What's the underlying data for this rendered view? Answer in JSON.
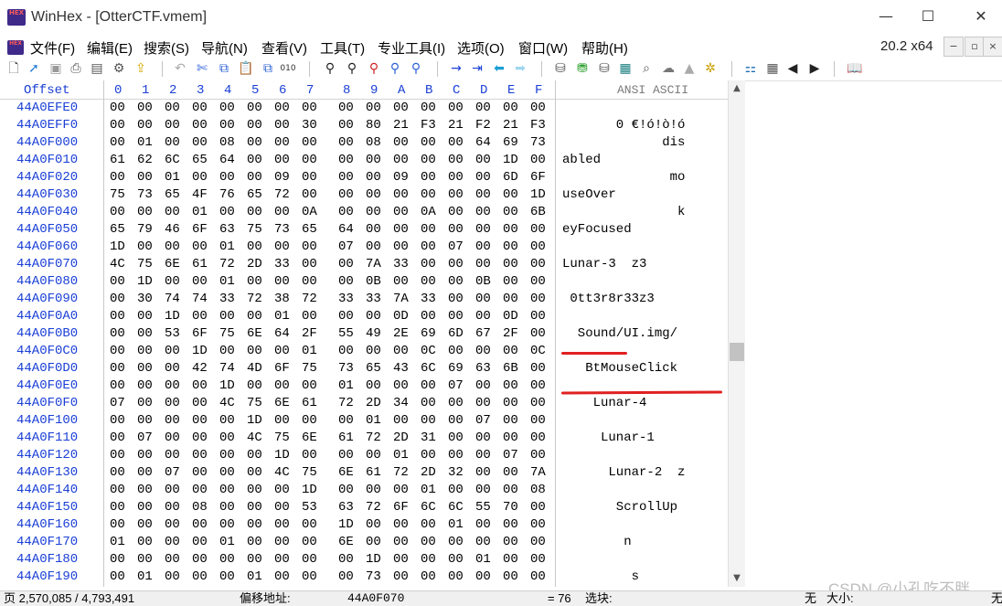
{
  "window": {
    "title": "WinHex - [OtterCTF.vmem]",
    "logo_text": "HEX",
    "minimize": "—",
    "maximize": "☐",
    "close": "✕"
  },
  "menu": {
    "items": [
      "文件(F)",
      "编辑(E)",
      "搜索(S)",
      "导航(N)",
      "查看(V)",
      "工具(T)",
      "专业工具(I)",
      "选项(O)",
      "窗口(W)",
      "帮助(H)"
    ],
    "version": "20.2 x64",
    "mdi": [
      "−",
      "▫",
      "×"
    ]
  },
  "hex": {
    "offset_label": "Offset",
    "column_labels": [
      "0",
      "1",
      "2",
      "3",
      "4",
      "5",
      "6",
      "7",
      "8",
      "9",
      "A",
      "B",
      "C",
      "D",
      "E",
      "F"
    ],
    "ascii_label": "ANSI ASCII",
    "rows": [
      {
        "offset": "44A0EFE0",
        "bytes": [
          "00",
          "00",
          "00",
          "00",
          "00",
          "00",
          "00",
          "00",
          "00",
          "00",
          "00",
          "00",
          "00",
          "00",
          "00",
          "00"
        ],
        "ascii": ""
      },
      {
        "offset": "44A0EFF0",
        "bytes": [
          "00",
          "00",
          "00",
          "00",
          "00",
          "00",
          "00",
          "30",
          "00",
          "80",
          "21",
          "F3",
          "21",
          "F2",
          "21",
          "F3"
        ],
        "ascii": "       0 €!ó!ò!ó"
      },
      {
        "offset": "44A0F000",
        "bytes": [
          "00",
          "01",
          "00",
          "00",
          "08",
          "00",
          "00",
          "00",
          "00",
          "08",
          "00",
          "00",
          "00",
          "64",
          "69",
          "73"
        ],
        "ascii": "             dis"
      },
      {
        "offset": "44A0F010",
        "bytes": [
          "61",
          "62",
          "6C",
          "65",
          "64",
          "00",
          "00",
          "00",
          "00",
          "00",
          "00",
          "00",
          "00",
          "00",
          "1D",
          "00"
        ],
        "ascii": "abled"
      },
      {
        "offset": "44A0F020",
        "bytes": [
          "00",
          "00",
          "01",
          "00",
          "00",
          "00",
          "09",
          "00",
          "00",
          "00",
          "09",
          "00",
          "00",
          "00",
          "6D",
          "6F"
        ],
        "ascii": "              mo"
      },
      {
        "offset": "44A0F030",
        "bytes": [
          "75",
          "73",
          "65",
          "4F",
          "76",
          "65",
          "72",
          "00",
          "00",
          "00",
          "00",
          "00",
          "00",
          "00",
          "00",
          "1D"
        ],
        "ascii": "useOver"
      },
      {
        "offset": "44A0F040",
        "bytes": [
          "00",
          "00",
          "00",
          "01",
          "00",
          "00",
          "00",
          "0A",
          "00",
          "00",
          "00",
          "0A",
          "00",
          "00",
          "00",
          "6B"
        ],
        "ascii": "               k"
      },
      {
        "offset": "44A0F050",
        "bytes": [
          "65",
          "79",
          "46",
          "6F",
          "63",
          "75",
          "73",
          "65",
          "64",
          "00",
          "00",
          "00",
          "00",
          "00",
          "00",
          "00"
        ],
        "ascii": "eyFocused"
      },
      {
        "offset": "44A0F060",
        "bytes": [
          "1D",
          "00",
          "00",
          "00",
          "01",
          "00",
          "00",
          "00",
          "07",
          "00",
          "00",
          "00",
          "07",
          "00",
          "00",
          "00"
        ],
        "ascii": ""
      },
      {
        "offset": "44A0F070",
        "bytes": [
          "4C",
          "75",
          "6E",
          "61",
          "72",
          "2D",
          "33",
          "00",
          "00",
          "7A",
          "33",
          "00",
          "00",
          "00",
          "00",
          "00"
        ],
        "ascii": "Lunar-3  z3"
      },
      {
        "offset": "44A0F080",
        "bytes": [
          "00",
          "1D",
          "00",
          "00",
          "01",
          "00",
          "00",
          "00",
          "00",
          "0B",
          "00",
          "00",
          "00",
          "0B",
          "00",
          "00"
        ],
        "ascii": ""
      },
      {
        "offset": "44A0F090",
        "bytes": [
          "00",
          "30",
          "74",
          "74",
          "33",
          "72",
          "38",
          "72",
          "33",
          "33",
          "7A",
          "33",
          "00",
          "00",
          "00",
          "00"
        ],
        "ascii": " 0tt3r8r33z3"
      },
      {
        "offset": "44A0F0A0",
        "bytes": [
          "00",
          "00",
          "1D",
          "00",
          "00",
          "00",
          "01",
          "00",
          "00",
          "00",
          "0D",
          "00",
          "00",
          "00",
          "0D",
          "00"
        ],
        "ascii": ""
      },
      {
        "offset": "44A0F0B0",
        "bytes": [
          "00",
          "00",
          "53",
          "6F",
          "75",
          "6E",
          "64",
          "2F",
          "55",
          "49",
          "2E",
          "69",
          "6D",
          "67",
          "2F",
          "00"
        ],
        "ascii": "  Sound/UI.img/"
      },
      {
        "offset": "44A0F0C0",
        "bytes": [
          "00",
          "00",
          "00",
          "1D",
          "00",
          "00",
          "00",
          "01",
          "00",
          "00",
          "00",
          "0C",
          "00",
          "00",
          "00",
          "0C"
        ],
        "ascii": ""
      },
      {
        "offset": "44A0F0D0",
        "bytes": [
          "00",
          "00",
          "00",
          "42",
          "74",
          "4D",
          "6F",
          "75",
          "73",
          "65",
          "43",
          "6C",
          "69",
          "63",
          "6B",
          "00"
        ],
        "ascii": "   BtMouseClick"
      },
      {
        "offset": "44A0F0E0",
        "bytes": [
          "00",
          "00",
          "00",
          "00",
          "1D",
          "00",
          "00",
          "00",
          "01",
          "00",
          "00",
          "00",
          "07",
          "00",
          "00",
          "00"
        ],
        "ascii": ""
      },
      {
        "offset": "44A0F0F0",
        "bytes": [
          "07",
          "00",
          "00",
          "00",
          "4C",
          "75",
          "6E",
          "61",
          "72",
          "2D",
          "34",
          "00",
          "00",
          "00",
          "00",
          "00"
        ],
        "ascii": "    Lunar-4"
      },
      {
        "offset": "44A0F100",
        "bytes": [
          "00",
          "00",
          "00",
          "00",
          "00",
          "1D",
          "00",
          "00",
          "00",
          "01",
          "00",
          "00",
          "00",
          "07",
          "00",
          "00"
        ],
        "ascii": ""
      },
      {
        "offset": "44A0F110",
        "bytes": [
          "00",
          "07",
          "00",
          "00",
          "00",
          "4C",
          "75",
          "6E",
          "61",
          "72",
          "2D",
          "31",
          "00",
          "00",
          "00",
          "00"
        ],
        "ascii": "     Lunar-1"
      },
      {
        "offset": "44A0F120",
        "bytes": [
          "00",
          "00",
          "00",
          "00",
          "00",
          "00",
          "1D",
          "00",
          "00",
          "00",
          "01",
          "00",
          "00",
          "00",
          "07",
          "00"
        ],
        "ascii": ""
      },
      {
        "offset": "44A0F130",
        "bytes": [
          "00",
          "00",
          "07",
          "00",
          "00",
          "00",
          "4C",
          "75",
          "6E",
          "61",
          "72",
          "2D",
          "32",
          "00",
          "00",
          "7A"
        ],
        "ascii": "      Lunar-2  z"
      },
      {
        "offset": "44A0F140",
        "bytes": [
          "00",
          "00",
          "00",
          "00",
          "00",
          "00",
          "00",
          "1D",
          "00",
          "00",
          "00",
          "01",
          "00",
          "00",
          "00",
          "08"
        ],
        "ascii": ""
      },
      {
        "offset": "44A0F150",
        "bytes": [
          "00",
          "00",
          "00",
          "08",
          "00",
          "00",
          "00",
          "53",
          "63",
          "72",
          "6F",
          "6C",
          "6C",
          "55",
          "70",
          "00"
        ],
        "ascii": "       ScrollUp"
      },
      {
        "offset": "44A0F160",
        "bytes": [
          "00",
          "00",
          "00",
          "00",
          "00",
          "00",
          "00",
          "00",
          "1D",
          "00",
          "00",
          "00",
          "01",
          "00",
          "00",
          "00"
        ],
        "ascii": ""
      },
      {
        "offset": "44A0F170",
        "bytes": [
          "01",
          "00",
          "00",
          "00",
          "01",
          "00",
          "00",
          "00",
          "6E",
          "00",
          "00",
          "00",
          "00",
          "00",
          "00",
          "00"
        ],
        "ascii": "        n"
      },
      {
        "offset": "44A0F180",
        "bytes": [
          "00",
          "00",
          "00",
          "00",
          "00",
          "00",
          "00",
          "00",
          "00",
          "1D",
          "00",
          "00",
          "00",
          "01",
          "00",
          "00"
        ],
        "ascii": ""
      },
      {
        "offset": "44A0F190",
        "bytes": [
          "00",
          "01",
          "00",
          "00",
          "00",
          "01",
          "00",
          "00",
          "00",
          "73",
          "00",
          "00",
          "00",
          "00",
          "00",
          "00"
        ],
        "ascii": "         s"
      }
    ]
  },
  "status": {
    "page": "页 2,570,085 / 4,793,491",
    "offset_label": "偏移地址:",
    "offset_value": "44A0F070",
    "value": "= 76",
    "select_label": "选块:",
    "none": "无",
    "size_label": "大小:",
    "none2": "无"
  },
  "watermark": "CSDN @小孔吃不胖"
}
